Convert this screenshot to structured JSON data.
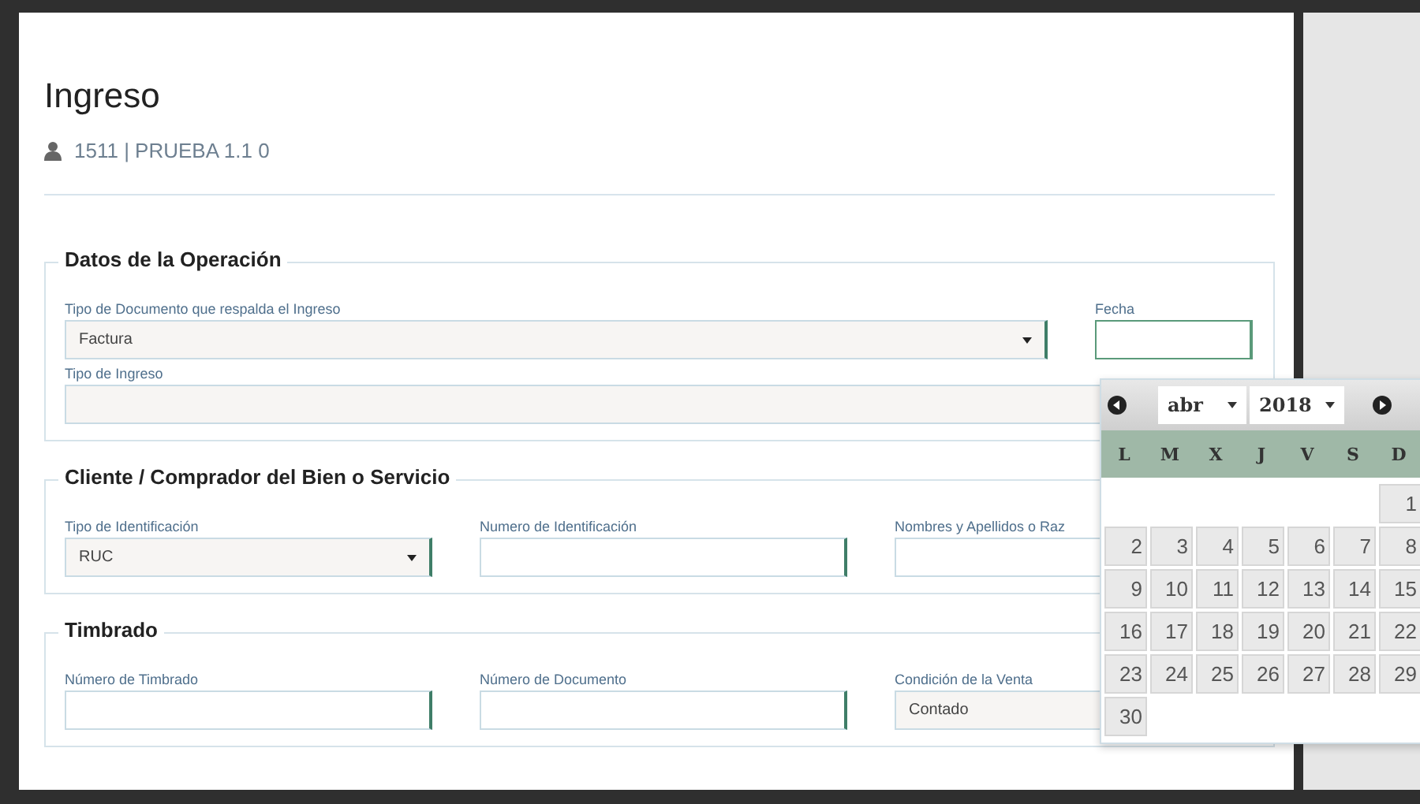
{
  "title": "Ingreso",
  "subtitle": "1511 | PRUEBA 1.1 0",
  "sections": [
    {
      "legend": "Datos de la Operación",
      "rows": [
        [
          {
            "label": "Tipo de Documento que respalda el Ingreso",
            "kind": "select",
            "value": "Factura",
            "focused": false
          },
          {
            "label": "Fecha",
            "kind": "text",
            "focused": true
          }
        ],
        [
          {
            "label": "Tipo de Ingreso",
            "kind": "select",
            "focused": false
          }
        ]
      ]
    },
    {
      "legend": "Cliente / Comprador del Bien o Servicio",
      "rows": [
        [
          {
            "label": "Tipo de Identificación",
            "kind": "select",
            "value": "RUC",
            "focused": false
          },
          {
            "label": "Numero de Identificación",
            "kind": "text",
            "focused": false
          },
          {
            "label": "Nombres y Apellidos o Raz",
            "kind": "text",
            "focused": false
          }
        ]
      ]
    },
    {
      "legend": "Timbrado",
      "rows": [
        [
          {
            "label": "Número de Timbrado",
            "kind": "text",
            "focused": false
          },
          {
            "label": "Número de Documento",
            "kind": "text",
            "focused": false
          },
          {
            "label": "Condición de la Venta",
            "kind": "select",
            "value": "Contado",
            "focused": false
          }
        ]
      ]
    }
  ],
  "datepicker": {
    "month": "abr",
    "year": "2018",
    "weekdays": [
      "L",
      "M",
      "X",
      "J",
      "V",
      "S",
      "D"
    ],
    "weeks": [
      [
        "1"
      ],
      [
        "2",
        "3",
        "4",
        "5",
        "6",
        "7",
        "8"
      ],
      [
        "9",
        "10",
        "11",
        "12",
        "13",
        "14",
        "15"
      ],
      [
        "16",
        "17",
        "18",
        "19",
        "20",
        "21",
        "22"
      ],
      [
        "23",
        "24",
        "25",
        "26",
        "27",
        "28",
        "29"
      ],
      [
        "30"
      ]
    ]
  }
}
